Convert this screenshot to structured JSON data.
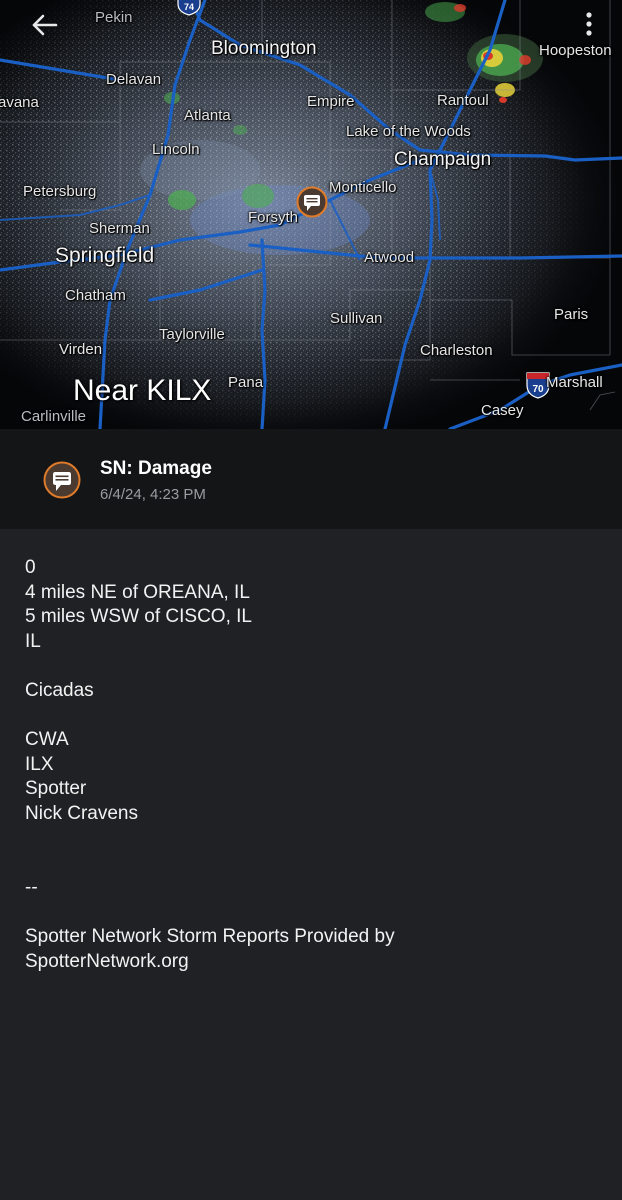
{
  "map": {
    "location_label": "Near KILX",
    "back_icon": "arrow-left-icon",
    "menu_icon": "more-vert-icon",
    "pin_icon": "report-chat-icon",
    "cities": [
      {
        "id": "pekin",
        "name": "Pekin"
      },
      {
        "id": "bloomington",
        "name": "Bloomington"
      },
      {
        "id": "hoopeston",
        "name": "Hoopeston"
      },
      {
        "id": "delavan",
        "name": "Delavan"
      },
      {
        "id": "havana",
        "name": "avana"
      },
      {
        "id": "atlanta",
        "name": "Atlanta"
      },
      {
        "id": "empire",
        "name": "Empire"
      },
      {
        "id": "rantoul",
        "name": "Rantoul"
      },
      {
        "id": "lake-of-the-woods",
        "name": "Lake of the Woods"
      },
      {
        "id": "lincoln",
        "name": "Lincoln"
      },
      {
        "id": "champaign",
        "name": "Champaign"
      },
      {
        "id": "petersburg",
        "name": "Petersburg"
      },
      {
        "id": "monticello",
        "name": "Monticello"
      },
      {
        "id": "forsyth",
        "name": "Forsyth"
      },
      {
        "id": "sherman",
        "name": "Sherman"
      },
      {
        "id": "springfield",
        "name": "Springfield"
      },
      {
        "id": "atwood",
        "name": "Atwood"
      },
      {
        "id": "chatham",
        "name": "Chatham"
      },
      {
        "id": "paris",
        "name": "Paris"
      },
      {
        "id": "sullivan",
        "name": "Sullivan"
      },
      {
        "id": "taylorville",
        "name": "Taylorville"
      },
      {
        "id": "virden",
        "name": "Virden"
      },
      {
        "id": "charleston",
        "name": "Charleston"
      },
      {
        "id": "pana",
        "name": "Pana"
      },
      {
        "id": "marshall",
        "name": "Marshall"
      },
      {
        "id": "carlinville",
        "name": "Carlinville"
      },
      {
        "id": "casey",
        "name": "Casey"
      }
    ],
    "shields": [
      {
        "id": "i74",
        "number": "74"
      },
      {
        "id": "i70",
        "number": "70"
      }
    ]
  },
  "report": {
    "title": "SN: Damage",
    "timestamp": "6/4/24, 4:23 PM",
    "icon": "chat-bubble-icon",
    "accent_color": "#e07b2a",
    "lines": [
      "0",
      "4 miles NE of OREANA, IL",
      "5 miles WSW of CISCO, IL",
      "IL",
      "",
      "Cicadas",
      "",
      "CWA",
      "ILX",
      "Spotter",
      "Nick Cravens",
      "",
      "",
      "--",
      "",
      "Spotter Network Storm Reports Provided by",
      "SpotterNetwork.org"
    ]
  },
  "colors": {
    "map_background": "#050608",
    "header_background": "#141517",
    "body_background": "#1f2124",
    "highway": "#1a5fc4",
    "radar_light": "#7c8aa0",
    "radar_green": "#4caf50",
    "radar_yellow": "#e8d23a",
    "radar_red": "#d83a2a"
  }
}
